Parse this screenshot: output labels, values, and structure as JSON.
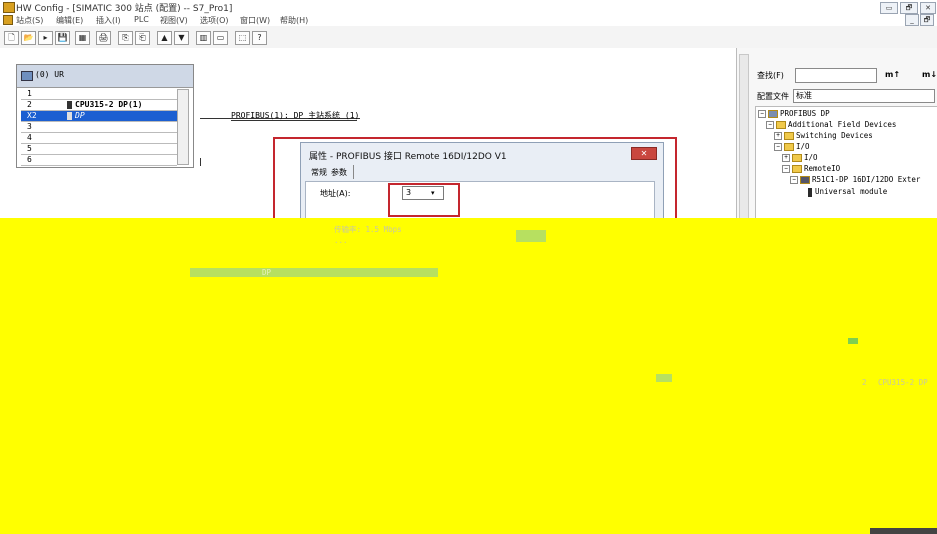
{
  "window": {
    "title": "HW Config - [SIMATIC 300 站点 (配置) -- S7_Pro1]",
    "controls": [
      "▭",
      "🗗",
      "✕"
    ],
    "doc_controls": [
      "_",
      "🗗"
    ]
  },
  "menu": [
    "站点(S)",
    "编辑(E)",
    "插入(I)",
    "PLC",
    "视图(V)",
    "选项(O)",
    "窗口(W)",
    "帮助(H)"
  ],
  "toolbar": [
    "🗋",
    "📂",
    "▸",
    "💾",
    "▦",
    "🖨",
    "⎘",
    "⎗",
    "▲",
    "▼",
    "▥",
    "▭",
    "⬚",
    "?"
  ],
  "rack": {
    "title": "(0) UR",
    "slots": [
      {
        "num": "1",
        "module": ""
      },
      {
        "num": "2",
        "module": "CPU315-2 DP(1)"
      },
      {
        "num": "X2",
        "module": "DP"
      },
      {
        "num": "3",
        "module": ""
      },
      {
        "num": "4",
        "module": ""
      },
      {
        "num": "5",
        "module": ""
      },
      {
        "num": "6",
        "module": ""
      }
    ]
  },
  "profibus_label": "PROFIBUS(1): DP 主站系统 (1)",
  "dialog": {
    "title": "属性 - PROFIBUS 接口  Remote 16DI/12DO V1",
    "close": "✕",
    "tabs": [
      "常规",
      "参数"
    ],
    "address_label": "地址(A):",
    "address_value": "3",
    "dropdown_arrow": "▾"
  },
  "catalog": {
    "search_label": "查找(F)",
    "find_next": "m↑",
    "find_prev": "m↓",
    "profile_label": "配置文件",
    "profile_value": "标准",
    "tree": [
      {
        "level": 0,
        "label": "PROFIBUS DP",
        "toggle": "⊟",
        "kind": "root"
      },
      {
        "level": 1,
        "label": "Additional Field Devices",
        "toggle": "⊟",
        "kind": "folder"
      },
      {
        "level": 2,
        "label": "Switching Devices",
        "toggle": "⊞",
        "kind": "folder"
      },
      {
        "level": 2,
        "label": "I/O",
        "toggle": "⊟",
        "kind": "folder"
      },
      {
        "level": 3,
        "label": "I/O",
        "toggle": "⊞",
        "kind": "folder"
      },
      {
        "level": 3,
        "label": "RemoteIO",
        "toggle": "⊟",
        "kind": "folder"
      },
      {
        "level": 4,
        "label": "R51C1-DP 16DI/12DO Exter",
        "toggle": "⊟",
        "kind": "device"
      },
      {
        "level": 5,
        "label": "Universal module",
        "toggle": "",
        "kind": "module"
      }
    ]
  },
  "lower_overlay": {
    "left_texts": [
      "传输率: 1.5 Mbps",
      "..."
    ],
    "green_text": "DP",
    "right_texts": [
      "2",
      "CPU315-2 DP"
    ]
  }
}
